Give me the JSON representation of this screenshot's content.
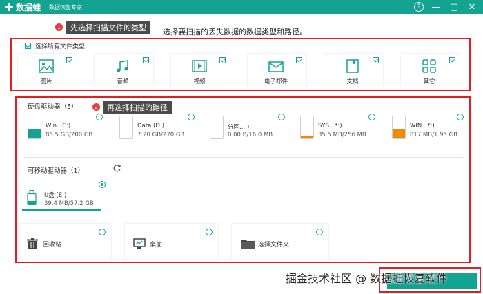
{
  "app": {
    "name": "数据蛙",
    "subtitle": "数据恢复专家",
    "accent": "#12a391"
  },
  "window_buttons": [
    "help-icon",
    "minimize-icon",
    "maximize-icon",
    "close-icon"
  ],
  "annotations": {
    "step1_badge": "1",
    "step1_text": "先选择扫描文件的类型",
    "step2_badge": "2",
    "step2_text": "再选择扫描的路径",
    "highlight_color": "#e02020"
  },
  "hint": "选择要扫描的丢失数据的数据类型和路径。",
  "file_types": {
    "select_all_label": "选择所有文件类型",
    "items": [
      {
        "label": "图片",
        "icon": "image-icon",
        "checked": true
      },
      {
        "label": "音频",
        "icon": "music-icon",
        "checked": true
      },
      {
        "label": "视频",
        "icon": "video-icon",
        "checked": true
      },
      {
        "label": "电子邮件",
        "icon": "email-icon",
        "checked": true
      },
      {
        "label": "文档",
        "icon": "document-icon",
        "checked": true
      },
      {
        "label": "其它",
        "icon": "other-icon",
        "checked": true
      }
    ]
  },
  "hard_drives": {
    "title": "硬盘驱动器（5）",
    "items": [
      {
        "name": "Win...C:)",
        "size": "86.5 GB/200 GB",
        "used_fraction": 0.43,
        "color": "#12a391",
        "selected": false
      },
      {
        "name": "Data (D:)",
        "size": "7.20 GB/270 GB",
        "used_fraction": 0.03,
        "color": "#12a391",
        "selected": false
      },
      {
        "name": "分区...:)",
        "size": "0.00  B/16.0 MB",
        "used_fraction": 0.0,
        "color": "#12a391",
        "selected": false
      },
      {
        "name": "SYS...*:)",
        "size": "35.5 MB/256 MB",
        "used_fraction": 0.14,
        "color": "#f08a00",
        "selected": false
      },
      {
        "name": "WIN...*:)",
        "size": "817 MB/1.95 GB",
        "used_fraction": 0.41,
        "color": "#f08a00",
        "selected": false
      }
    ]
  },
  "removable_drives": {
    "title": "可移动驱动器（1）",
    "refresh_icon": "refresh-icon",
    "items": [
      {
        "name": "U盘 (E:)",
        "size": "39.4 MB/57.2 GB",
        "icon": "usb-drive-icon",
        "selected": true
      }
    ]
  },
  "locations": [
    {
      "label": "回收站",
      "icon": "recycle-bin-icon"
    },
    {
      "label": "桌面",
      "icon": "desktop-icon"
    },
    {
      "label": "选择文件夹",
      "icon": "folder-icon"
    }
  ],
  "watermark": "掘金技术社区 @ 数据蛙恢复软件"
}
